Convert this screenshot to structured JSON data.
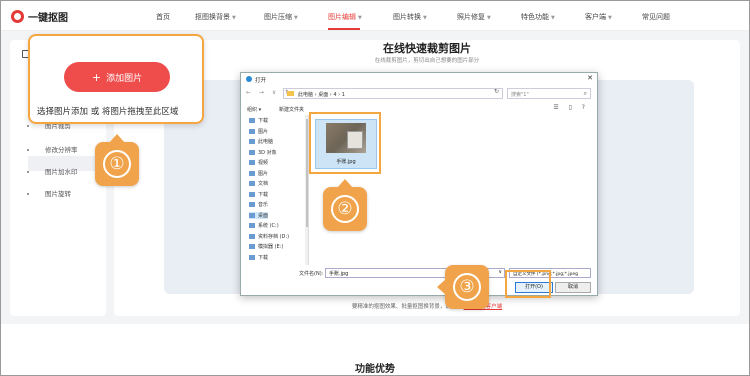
{
  "header": {
    "logo_text": "一键抠图",
    "nav": [
      {
        "label": "首页",
        "dropdown": false
      },
      {
        "label": "抠图换背景",
        "dropdown": true
      },
      {
        "label": "图片压缩",
        "dropdown": true
      },
      {
        "label": "图片编辑",
        "dropdown": true,
        "active": true
      },
      {
        "label": "图片转换",
        "dropdown": true
      },
      {
        "label": "照片修复",
        "dropdown": true
      },
      {
        "label": "特色功能",
        "dropdown": true
      },
      {
        "label": "客户端",
        "dropdown": true
      },
      {
        "label": "常见问题",
        "dropdown": false
      }
    ]
  },
  "sidebar": {
    "items": [
      "图片裁剪",
      "修改分辨率",
      "图片加水印",
      "图片旋转"
    ]
  },
  "main": {
    "title": "在线快速裁剪图片",
    "subtitle": "在线裁剪图片，剪切出自己想要的图片部分",
    "bottom_note_prefix": "要精准的抠图效果、批量抠图换背景，请下载",
    "bottom_note_link": "一键抠图客户端"
  },
  "upload": {
    "button_label": "添加图片",
    "hint": "选择图片添加 或 将图片拖拽至此区域"
  },
  "badges": [
    "①",
    "②",
    "③"
  ],
  "dialog": {
    "title": "打开",
    "address": [
      "此电脑",
      "桌面",
      "4",
      "1"
    ],
    "search_placeholder": "搜索\"1\"",
    "toolbar": {
      "organize": "组织 ▾",
      "new_folder": "新建文件夹"
    },
    "tree": [
      "下载",
      "图片",
      "此电脑",
      "3D 对象",
      "视频",
      "图片",
      "文档",
      "下载",
      "音乐",
      "桌面",
      "系统 (C:)",
      "资料存档 (D:)",
      "模拟器 (E:)",
      "下载"
    ],
    "tree_selected": 9,
    "file_name": "手账.jpg",
    "filename_label": "文件名(N):",
    "filename_value": "手账.jpg",
    "filter": "自定义文件 (*.png;*.jpg;*.jpeg",
    "open_label": "打开(O)",
    "cancel_label": "取消"
  },
  "footer": {
    "section_title": "功能优势"
  }
}
